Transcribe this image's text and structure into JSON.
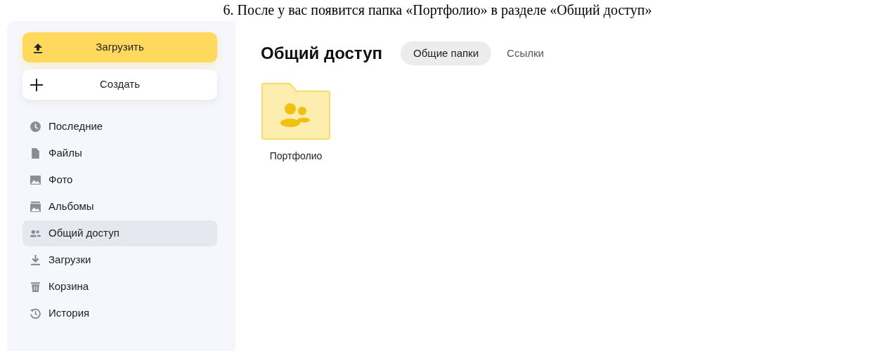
{
  "caption": "6. После у вас появится папка «Портфолио» в разделе «Общий доступ»",
  "sidebar": {
    "upload_button": "Загрузить",
    "create_button": "Создать",
    "items": [
      {
        "label": "Последние",
        "selected": false
      },
      {
        "label": "Файлы",
        "selected": false
      },
      {
        "label": "Фото",
        "selected": false
      },
      {
        "label": "Альбомы",
        "selected": false
      },
      {
        "label": "Общий доступ",
        "selected": true
      },
      {
        "label": "Загрузки",
        "selected": false
      },
      {
        "label": "Корзина",
        "selected": false
      },
      {
        "label": "История",
        "selected": false
      }
    ]
  },
  "main": {
    "title": "Общий доступ",
    "tabs": [
      {
        "label": "Общие папки",
        "selected": true
      },
      {
        "label": "Ссылки",
        "selected": false
      }
    ],
    "folders": [
      {
        "name": "Портфолио"
      }
    ]
  }
}
